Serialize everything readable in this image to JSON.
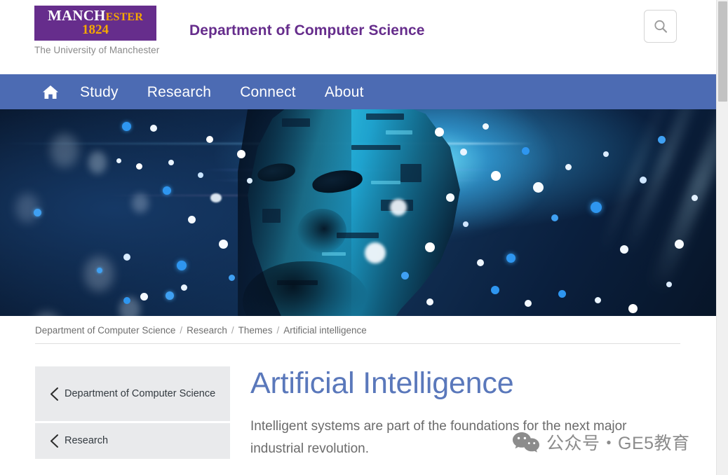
{
  "header": {
    "logo": {
      "word_part1": "MANCH",
      "word_part2": "ESTER",
      "year": "1824",
      "tagline": "The University of Manchester"
    },
    "site_title": "Department of Computer Science",
    "search_icon": "search-icon"
  },
  "nav": {
    "home_icon": "home-icon",
    "items": [
      {
        "label": "Study"
      },
      {
        "label": "Research"
      },
      {
        "label": "Connect"
      },
      {
        "label": "About"
      }
    ]
  },
  "hero": {
    "alt": "artificial-intelligence-digital-head-banner"
  },
  "breadcrumb": {
    "items": [
      {
        "label": "Department of Computer Science"
      },
      {
        "label": "Research"
      },
      {
        "label": "Themes"
      },
      {
        "label": "Artificial intelligence"
      }
    ],
    "separator": "/"
  },
  "sidebar": {
    "items": [
      {
        "label": "Department of Computer Science",
        "icon": "chevron-left-icon"
      },
      {
        "label": "Research",
        "icon": "chevron-left-icon"
      }
    ]
  },
  "main": {
    "title": "Artificial Intelligence",
    "intro": "Intelligent systems are part of the foundations for the next major industrial revolution."
  },
  "watermark": {
    "icon": "wechat-icon",
    "text": "公众号・GE5教育"
  },
  "colors": {
    "brand_purple": "#662d8c",
    "brand_gold": "#f5a800",
    "nav_blue": "#4c6bb3",
    "title_blue": "#5a78bb",
    "sidebar_gray": "#e9eaec"
  },
  "scrollbar": {
    "name": "vertical-scrollbar"
  }
}
